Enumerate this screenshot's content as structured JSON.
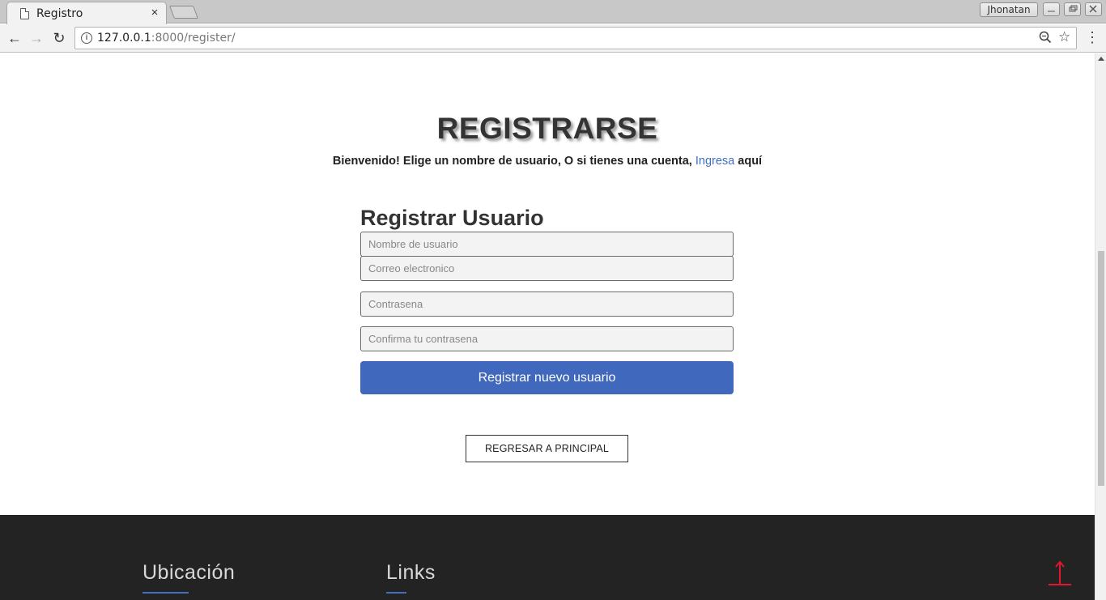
{
  "browser": {
    "tab_title": "Registro",
    "tab_close": "×",
    "profile_name": "Jhonatan",
    "url_host": "127.0.0.1",
    "url_path": ":8000/register/",
    "back": "←",
    "forward": "→",
    "reload": "↻",
    "icons": [
      "page-icon",
      "close-icon",
      "info-icon",
      "zoom-icon",
      "star-icon",
      "menu-icon"
    ]
  },
  "page": {
    "title": "REGISTRARSE",
    "welcome_text": "Bienvenido! Elige un nombre de usuario, O si tienes una cuenta, ",
    "login_link": "Ingresa",
    "welcome_suffix": " aquí",
    "form_title": "Registrar Usuario",
    "fields": {
      "username_placeholder": "Nombre de usuario",
      "email_placeholder": "Correo electronico",
      "password_placeholder": "Contrasena",
      "confirm_placeholder": "Confirma tu contrasena"
    },
    "submit_label": "Registrar nuevo usuario",
    "back_label": "REGRESAR A PRINCIPAL"
  },
  "footer": {
    "location_heading": "Ubicación",
    "links_heading": "Links"
  },
  "colors": {
    "accent": "#4068bd",
    "link": "#3f6fc1",
    "footer_bg": "#232323",
    "scroll_top_arrow": "#e0182d"
  }
}
